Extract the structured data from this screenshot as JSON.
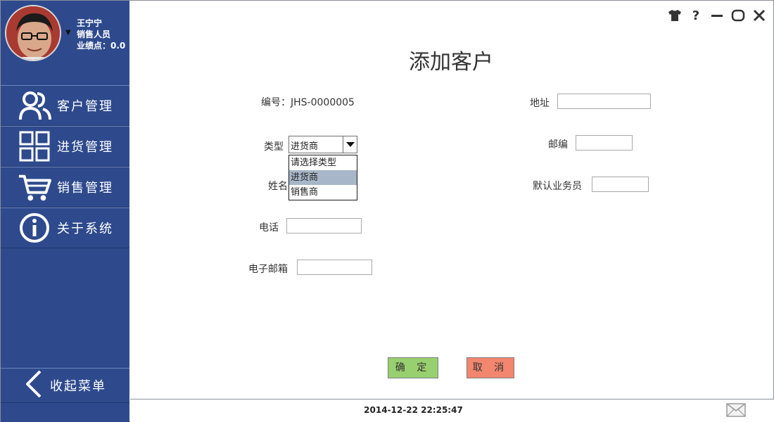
{
  "user": {
    "name": "王宁宁",
    "role": "销售人员",
    "score": "业绩点：0.0"
  },
  "nav": {
    "items": [
      {
        "label": "客户管理",
        "icon": "users-icon"
      },
      {
        "label": "进货管理",
        "icon": "grid-icon"
      },
      {
        "label": "销售管理",
        "icon": "cart-icon"
      },
      {
        "label": "关于系统",
        "icon": "info-icon"
      }
    ],
    "collapse_label": "收起菜单"
  },
  "window": {
    "controls": [
      "shirt-icon",
      "help-icon",
      "minimize-icon",
      "restore-icon",
      "close-icon"
    ],
    "help_glyph": "?"
  },
  "form": {
    "title": "添加客户",
    "id_label": "编号：JHS-0000005",
    "type_label": "类型",
    "type_value": "进货商",
    "type_options": [
      "请选择类型",
      "进货商",
      "销售商"
    ],
    "name_label": "姓名",
    "phone_label": "电话",
    "email_label": "电子邮箱",
    "address_label": "地址",
    "postcode_label": "邮编",
    "salesman_label": "默认业务员",
    "ok_label": "确 定",
    "cancel_label": "取 消"
  },
  "status": {
    "datetime": "2014-12-22 22:25:47"
  },
  "colors": {
    "sidebar": "#2e4a8d",
    "ok_button": "#98cf6f",
    "cancel_button": "#f3866f",
    "selected_option": "#a7b6c8"
  }
}
